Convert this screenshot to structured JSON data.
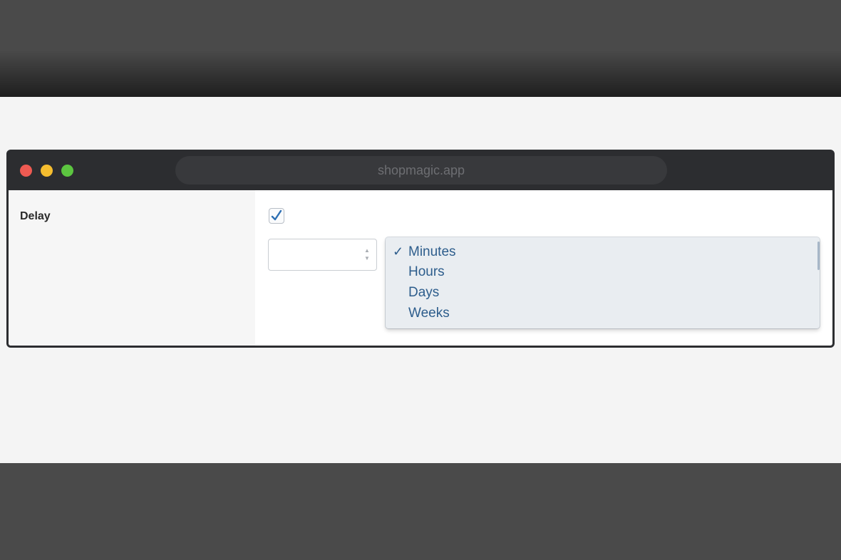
{
  "browser": {
    "url": "shopmagic.app"
  },
  "form": {
    "delay_label": "Delay",
    "delay_enabled": true,
    "delay_value": "",
    "unit_select": {
      "selected": "Minutes",
      "check_mark": "✓",
      "options": [
        "Minutes",
        "Hours",
        "Days",
        "Weeks"
      ]
    }
  },
  "icons": {
    "checkbox_mark": "checkmark-icon",
    "spinner": "spinner-arrows-icon"
  },
  "colors": {
    "accent": "#2d5d8c",
    "traffic_red": "#ee5a52",
    "traffic_yellow": "#f5bd2f",
    "traffic_green": "#5cc540"
  }
}
